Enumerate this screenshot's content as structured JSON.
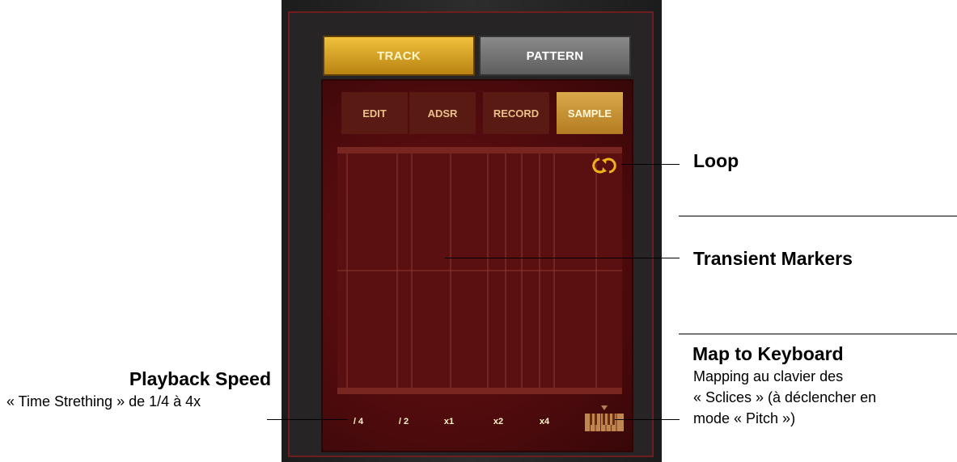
{
  "top_tabs": [
    {
      "label": "TRACK",
      "active": true
    },
    {
      "label": "PATTERN",
      "active": false
    }
  ],
  "sub_tabs": [
    {
      "label": "EDIT",
      "active": false
    },
    {
      "label": "ADSR",
      "active": false
    },
    {
      "label": "RECORD",
      "active": false
    },
    {
      "label": "SAMPLE",
      "active": true
    }
  ],
  "speed_buttons": [
    {
      "label": "/ 4",
      "active": true
    },
    {
      "label": "/ 2",
      "active": true
    },
    {
      "label": "x1",
      "active": false
    },
    {
      "label": "x2",
      "active": true
    },
    {
      "label": "x4",
      "active": true
    }
  ],
  "icons": {
    "loop": "loop-icon",
    "keyboard": "keyboard-icon"
  },
  "annotations": {
    "loop": {
      "title": "Loop"
    },
    "transient": {
      "title": "Transient Markers"
    },
    "keyboard": {
      "title": "Map to Keyboard",
      "lines": [
        "Mapping au clavier des",
        "« Sclices » (à déclencher en",
        "mode « Pitch »)"
      ]
    },
    "playback": {
      "title": "Playback Speed",
      "subtitle": "« Time Strething » de 1/4 à 4x"
    }
  },
  "colors": {
    "accent_gold": "#f0c13c",
    "panel_red": "#4a0a0c",
    "waveform_yellow": "#ffd400",
    "waveform_orange": "#ff6a00"
  }
}
